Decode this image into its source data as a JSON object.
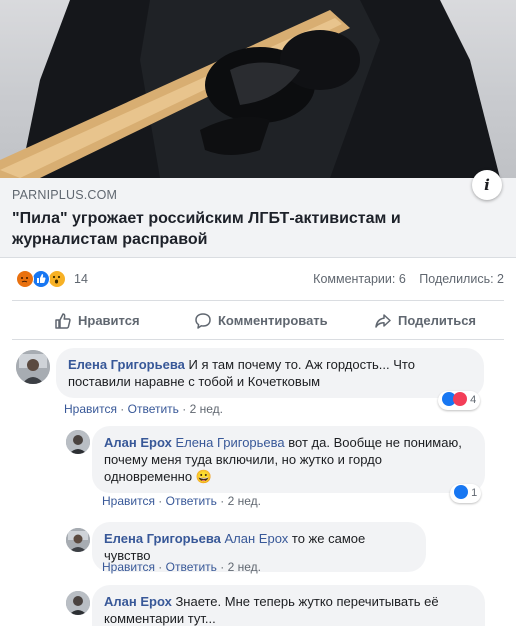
{
  "link_preview": {
    "domain": "PARNIPLUS.COM",
    "headline": "\"Пила\" угрожает российским ЛГБТ-активистам и журналистам расправой",
    "info_symbol": "i"
  },
  "stats": {
    "reactions": [
      "angry",
      "like",
      "wow"
    ],
    "reaction_count": "14",
    "comments": "Комментарии: 6",
    "shares": "Поделились: 2"
  },
  "actions": {
    "like": "Нравится",
    "comment": "Комментировать",
    "share": "Поделиться"
  },
  "comments": [
    {
      "author": "Елена Григорьева",
      "mention": "",
      "text_line1": "И я там почему то. Аж гордость... Что",
      "text_line2": "поставили наравне с тобой и Кочетковым",
      "text_line3": "",
      "like_label": "Нравится",
      "reply_label": "Ответить",
      "time": "2 нед.",
      "reaction_count": "4"
    },
    {
      "author": "Алан Ерох",
      "mention": "Елена Григорьева",
      "text_line1": "вот да. Вообще не понимаю,",
      "text_line2": "почему меня туда включили, но жутко и гордо",
      "text_line3": "одновременно",
      "emoji": "😀",
      "like_label": "Нравится",
      "reply_label": "Ответить",
      "time": "2 нед.",
      "reaction_count": "1"
    },
    {
      "author": "Елена Григорьева",
      "mention": "Алан Ерох",
      "text_line1": "то же самое чувство",
      "like_label": "Нравится",
      "reply_label": "Ответить",
      "time": "2 нед."
    },
    {
      "author": "Алан Ерох",
      "mention": "",
      "text_line1": "Знаете. Мне теперь жутко перечитывать её",
      "text_line2": "комментарии тут..."
    }
  ],
  "separator": "·",
  "colors": {
    "link_blue": "#385898",
    "like_blue": "#1877f2",
    "love_red": "#f33e58",
    "angry_orange": "#e9710f",
    "wow_yellow": "#f7b125",
    "bubble_bg": "#f2f3f5"
  }
}
